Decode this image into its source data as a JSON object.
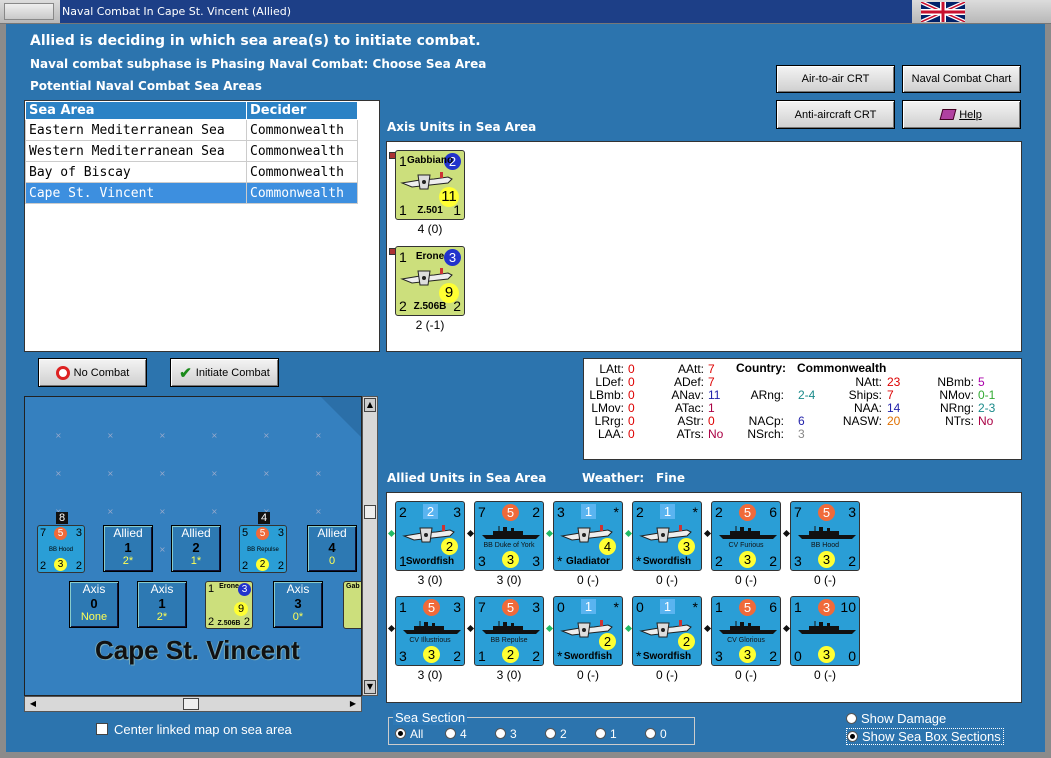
{
  "window": {
    "title": "Naval Combat In Cape St. Vincent (Allied)"
  },
  "header": {
    "line1": "Allied is deciding in which sea area(s) to initiate combat.",
    "line2": "Naval combat subphase is Phasing Naval Combat: Choose Sea Area",
    "line3": "Potential Naval Combat Sea Areas"
  },
  "buttons": {
    "air_to_air": "Air-to-air CRT",
    "naval_chart": "Naval Combat Chart",
    "anti_aircraft": "Anti-aircraft CRT",
    "help": "Help",
    "no_combat": "No Combat",
    "initiate": "Initiate Combat"
  },
  "sea_table": {
    "headers": [
      "Sea Area",
      "Decider"
    ],
    "rows": [
      [
        "Eastern Mediterranean Sea",
        "Commonwealth"
      ],
      [
        "Western Mediterranean Sea",
        "Commonwealth"
      ],
      [
        "Bay of Biscay",
        "Commonwealth"
      ],
      [
        "Cape St. Vincent",
        "Commonwealth"
      ]
    ],
    "selected": 3
  },
  "axis_section": {
    "title": "Axis Units in Sea Area",
    "units": [
      {
        "left": "1",
        "badge": "2",
        "name": "Gabbiano",
        "big": "11",
        "bl": "1",
        "code": "Z.501",
        "br": "1",
        "cap": "4 (0)"
      },
      {
        "left": "1",
        "badge": "3",
        "name": "Erone",
        "big": "9",
        "bl": "2",
        "code": "Z.506B",
        "br": "2",
        "cap": "2 (-1)"
      }
    ]
  },
  "stats": {
    "country_label": "Country:",
    "country": "Commonwealth",
    "col1": [
      [
        "LAtt:",
        "0"
      ],
      [
        "LDef:",
        "0"
      ],
      [
        "LBmb:",
        "0"
      ],
      [
        "LMov:",
        "0"
      ],
      [
        "LRrg:",
        "0"
      ],
      [
        "LAA:",
        "0"
      ]
    ],
    "col2": [
      [
        "AAtt:",
        "7"
      ],
      [
        "ADef:",
        "7"
      ],
      [
        "ANav:",
        "11"
      ],
      [
        "ATac:",
        "1"
      ],
      [
        "AStr:",
        "0"
      ],
      [
        "ATrs:",
        "No"
      ]
    ],
    "col3": [
      [
        "ARng:",
        "2-4"
      ],
      [
        "NACp:",
        "6"
      ],
      [
        "NSrch:",
        "3"
      ]
    ],
    "col4": [
      [
        "NAtt:",
        "23"
      ],
      [
        "Ships:",
        "7"
      ],
      [
        "NAA:",
        "14"
      ],
      [
        "NASW:",
        "20"
      ]
    ],
    "col5": [
      [
        "NBmb:",
        "5"
      ],
      [
        "NMov:",
        "0-1"
      ],
      [
        "NRng:",
        "2-3"
      ],
      [
        "NTrs:",
        "No"
      ]
    ]
  },
  "allied_section": {
    "title": "Allied Units in Sea Area",
    "weather_label": "Weather:",
    "weather": "Fine",
    "units": [
      {
        "type": "air",
        "tl": "2",
        "badge": "2",
        "tr": "3",
        "name": "Swordfish",
        "bl": "1",
        "yb": "2",
        "cap": "3 (0)"
      },
      {
        "type": "ship",
        "tl": "7",
        "badge": "5",
        "tr": "2",
        "name": "BB Duke of York",
        "bl": "3",
        "yb": "3",
        "br": "3",
        "cap": "3 (0)"
      },
      {
        "type": "air",
        "tl": "3",
        "badge": "1",
        "tr": "*",
        "name": "Gladiator",
        "bl": "*",
        "yb": "4",
        "cap": "0 (-)"
      },
      {
        "type": "air",
        "tl": "2",
        "badge": "1",
        "tr": "*",
        "name": "Swordfish",
        "bl": "*",
        "yb": "3",
        "cap": "0 (-)"
      },
      {
        "type": "ship",
        "tl": "2",
        "badge": "5",
        "tr": "6",
        "name": "CV Furious",
        "bl": "2",
        "yb": "3",
        "br": "2",
        "cap": "0 (-)"
      },
      {
        "type": "ship",
        "tl": "7",
        "badge": "5",
        "tr": "3",
        "name": "BB Hood",
        "bl": "3",
        "yb": "3",
        "br": "2",
        "cap": "0 (-)"
      },
      {
        "type": "ship",
        "tl": "1",
        "badge": "5",
        "tr": "3",
        "name": "CV Illustrious",
        "bl": "3",
        "yb": "3",
        "br": "2",
        "cap": "3 (0)"
      },
      {
        "type": "ship",
        "tl": "7",
        "badge": "5",
        "tr": "3",
        "name": "BB Repulse",
        "bl": "1",
        "yb": "2",
        "br": "2",
        "cap": "3 (0)"
      },
      {
        "type": "air",
        "tl": "0",
        "badge": "1",
        "tr": "*",
        "name": "Swordfish",
        "bl": "*",
        "yb": "2",
        "cap": "0 (-)"
      },
      {
        "type": "air",
        "tl": "0",
        "badge": "1",
        "tr": "*",
        "name": "Swordfish",
        "bl": "*",
        "yb": "2",
        "cap": "0 (-)"
      },
      {
        "type": "ship",
        "tl": "1",
        "badge": "5",
        "tr": "6",
        "name": "CV Glorious",
        "bl": "3",
        "yb": "3",
        "br": "2",
        "cap": "0 (-)"
      },
      {
        "type": "ship",
        "tl": "1",
        "badge": "3",
        "tr": "10",
        "name": "",
        "bl": "0",
        "yb": "3",
        "br": "0",
        "cap": "0 (-)"
      }
    ]
  },
  "map": {
    "sea_name": "Cape St. Vincent",
    "allied_boxes": [
      {
        "label": "Allied",
        "v": "1",
        "s": "2*"
      },
      {
        "label": "Allied",
        "v": "2",
        "s": "1*"
      },
      {
        "label": "Allied",
        "v": "4",
        "s": "0"
      }
    ],
    "axis_boxes": [
      {
        "label": "Axis",
        "v": "0",
        "s": "None"
      },
      {
        "label": "Axis",
        "v": "1",
        "s": "2*"
      },
      {
        "label": "Axis",
        "v": "3",
        "s": "0*"
      }
    ],
    "counters": [
      {
        "top": "8",
        "tl": "7",
        "b": "5",
        "tr": "3",
        "nm": "BB Hood",
        "bl": "2",
        "y": "3",
        "br": "2"
      },
      {
        "top": "4",
        "tl": "5",
        "b": "5",
        "tr": "3",
        "nm": "BB Repulse",
        "bl": "2",
        "y": "2",
        "br": "2"
      }
    ],
    "erone": {
      "tl": "1",
      "nm": "Erone",
      "b": "3",
      "big": "9",
      "bl": "2",
      "code": "Z.506B",
      "br": "2"
    },
    "partial": "Gab"
  },
  "footer": {
    "center_label": "Center linked map on sea area",
    "sea_section_label": "Sea Section",
    "sections": [
      "All",
      "4",
      "3",
      "2",
      "1",
      "0"
    ],
    "show_damage": "Show Damage",
    "show_sea_box": "Show Sea Box Sections"
  }
}
